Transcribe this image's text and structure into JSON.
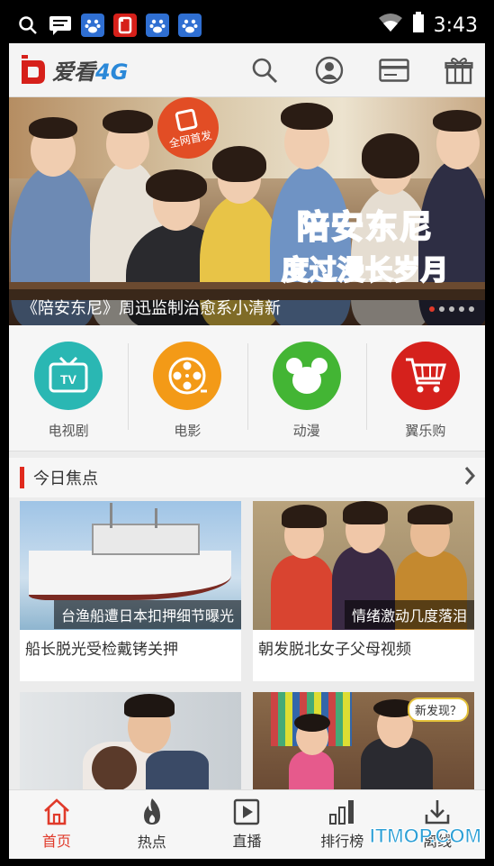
{
  "status": {
    "time": "3:43"
  },
  "header": {
    "logo_text_main": "爱看",
    "logo_text_suffix": "4G",
    "icons": [
      "search-icon",
      "user-icon",
      "card-icon",
      "gift-icon"
    ]
  },
  "banner": {
    "badge": "全网首发",
    "title_line1": "陪安东尼",
    "title_line2": "度过漫长岁月",
    "caption": "《陪安东尼》周迅监制治愈系小清新",
    "dot_count": 5,
    "active_dot": 0
  },
  "categories": [
    {
      "label": "电视剧",
      "icon": "tv-icon",
      "color": "#2ab7b3"
    },
    {
      "label": "电影",
      "icon": "film-reel-icon",
      "color": "#f39a17"
    },
    {
      "label": "动漫",
      "icon": "mickey-icon",
      "color": "#43b534"
    },
    {
      "label": "翼乐购",
      "icon": "cart-icon",
      "color": "#d5211c"
    }
  ],
  "section": {
    "title": "今日焦点"
  },
  "cards": [
    {
      "overlay": "台渔船遭日本扣押细节曝光",
      "title": "船长脱光受检戴铐关押"
    },
    {
      "overlay": "情绪激动几度落泪",
      "title": "朝发脱北女子父母视频"
    },
    {
      "overlay": "",
      "title": ""
    },
    {
      "overlay": "",
      "title": "",
      "sticker": "新发现？"
    }
  ],
  "bottom_nav": [
    {
      "label": "首页",
      "icon": "home-icon",
      "active": true
    },
    {
      "label": "热点",
      "icon": "flame-icon",
      "active": false
    },
    {
      "label": "直播",
      "icon": "play-icon",
      "active": false
    },
    {
      "label": "排行榜",
      "icon": "bars-icon",
      "active": false
    },
    {
      "label": "离线",
      "icon": "download-icon",
      "active": false
    }
  ],
  "watermark": "ITMOP.COM",
  "colors": {
    "accent": "#e03a2a",
    "logo_blue": "#2a88d8"
  }
}
